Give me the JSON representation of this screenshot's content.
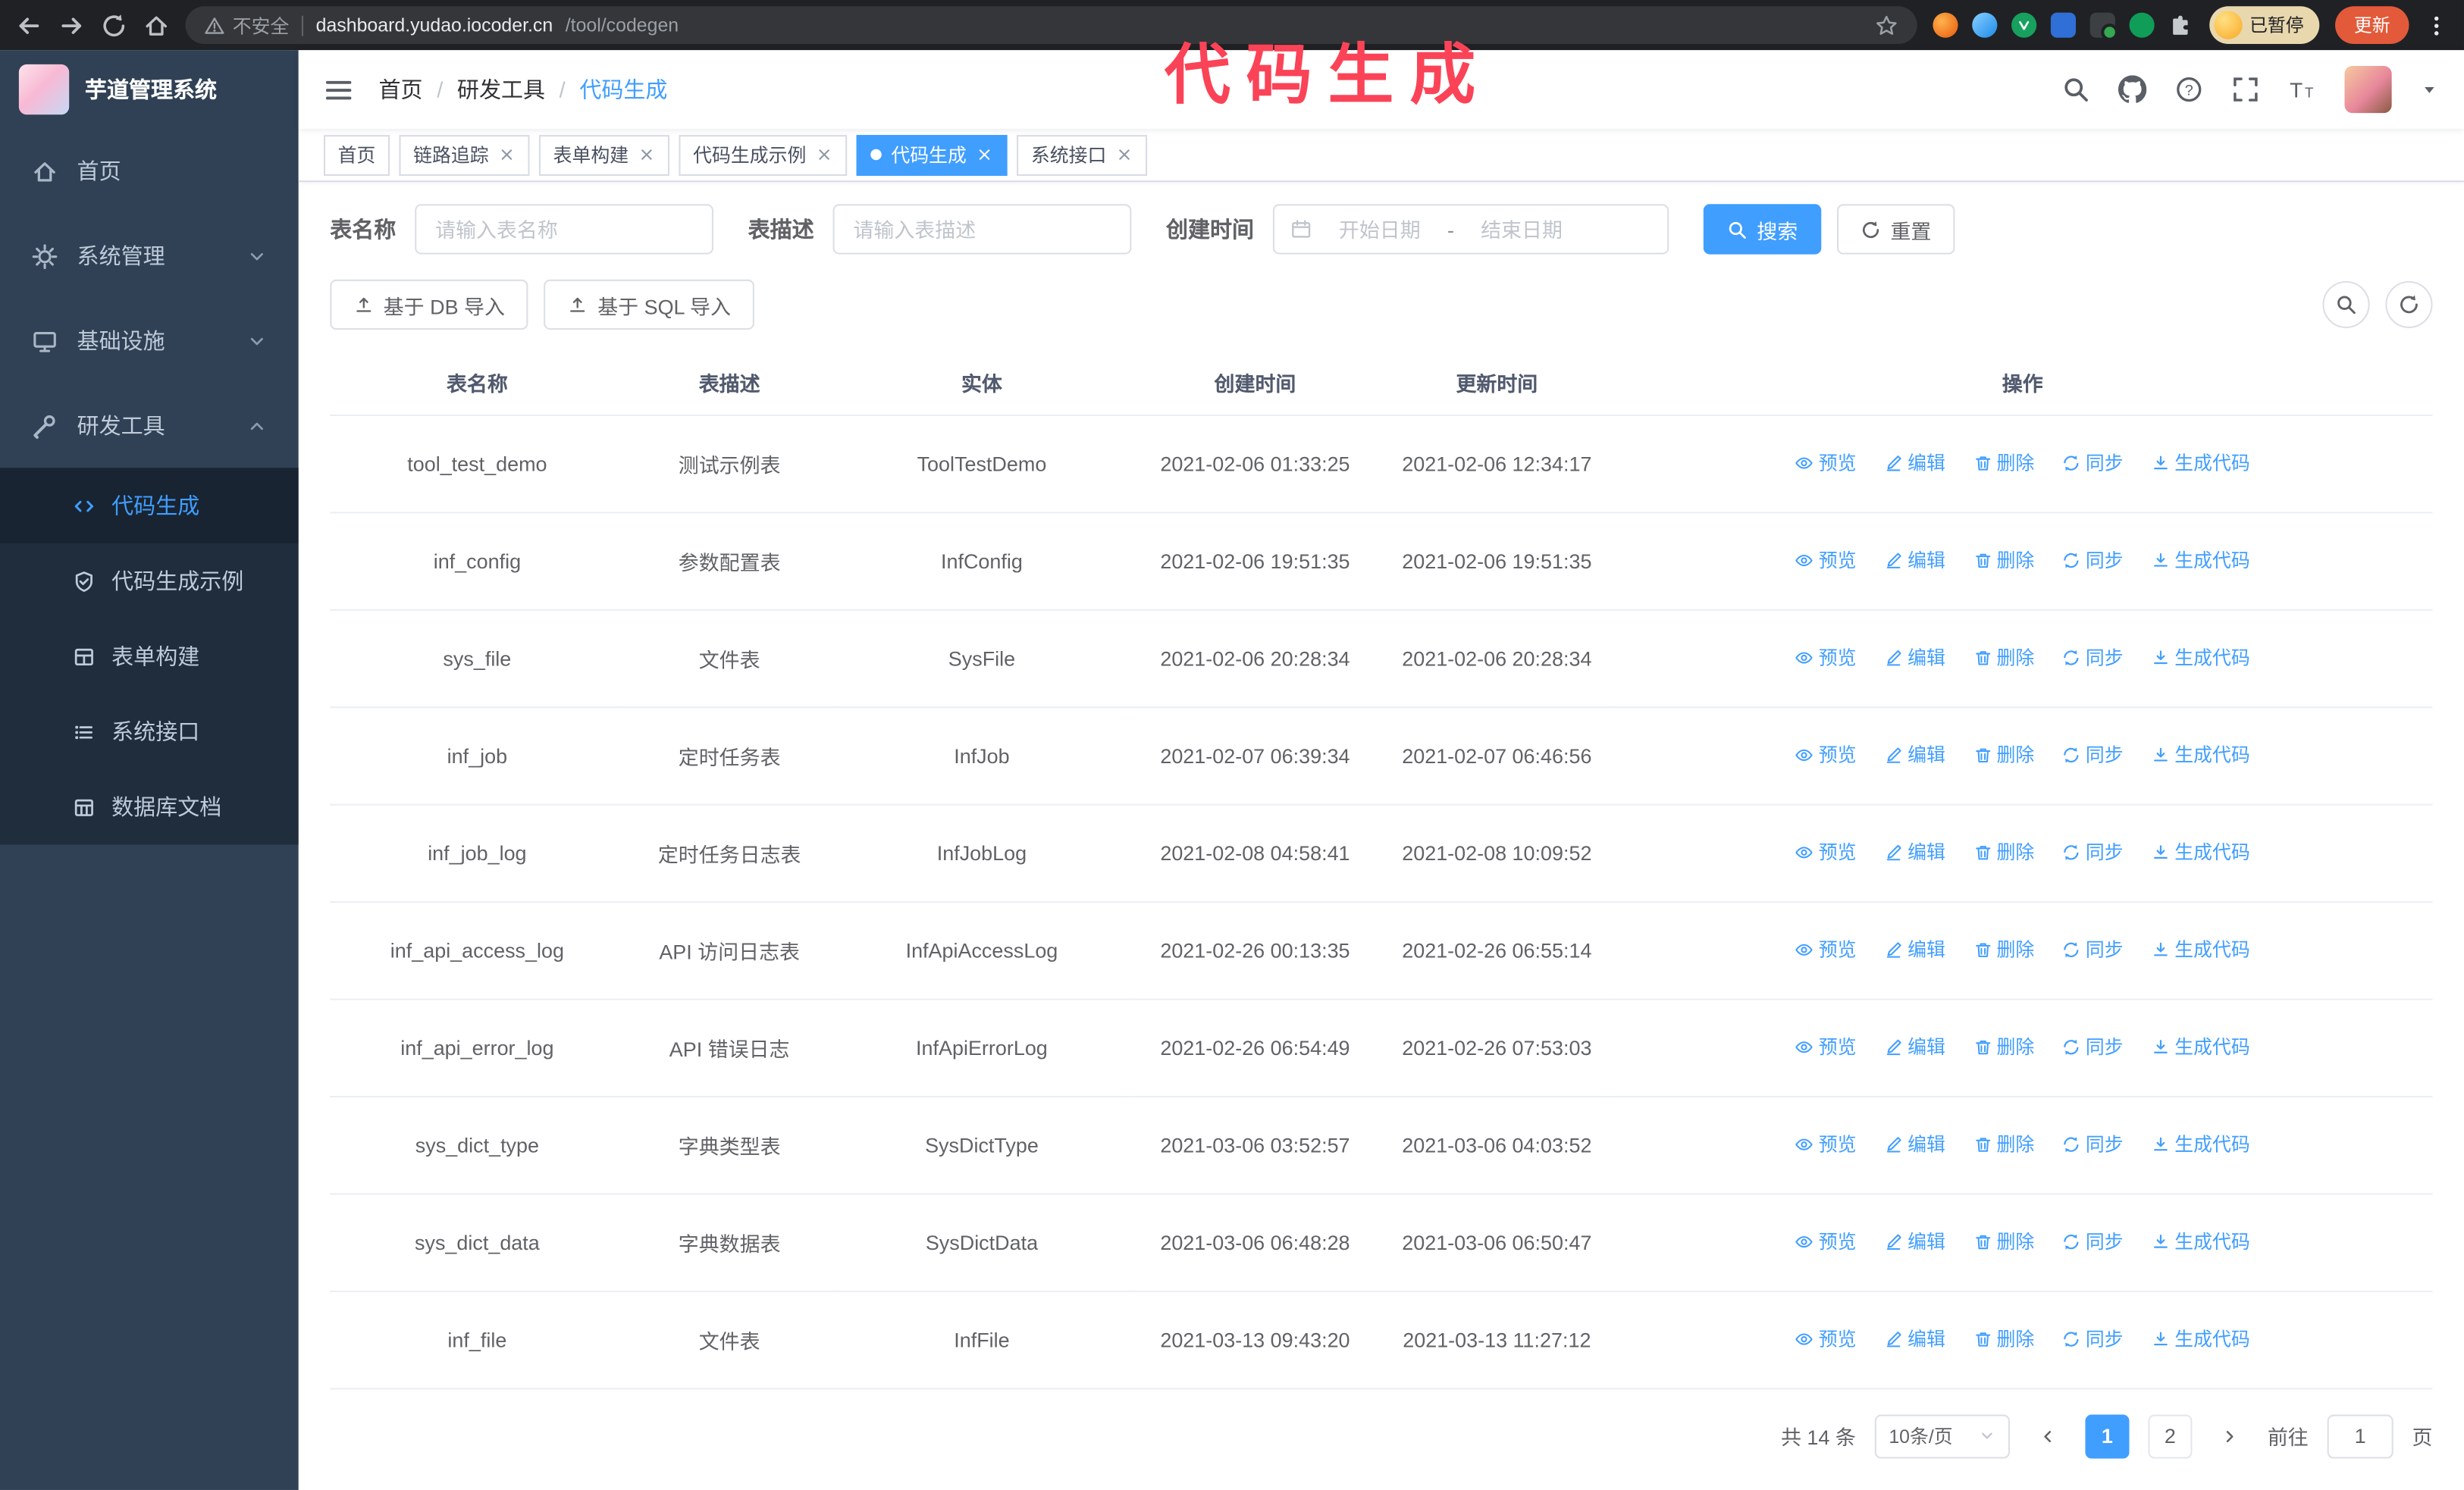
{
  "theme": {
    "accent": "#409eff",
    "sidebar_bg": "#304156",
    "submenu_bg": "#1f2d3d",
    "tab_active_bg": "#409eff",
    "annotation_color": "#fb4357",
    "update_button_bg": "#e25a3a"
  },
  "overlay": {
    "annotation": "代码生成"
  },
  "browser": {
    "security_warning": "不安全",
    "url_domain": "dashboard.yudao.iocoder.cn",
    "url_path": "/tool/codegen",
    "paused_badge": "已暂停",
    "update_button": "更新"
  },
  "sidebar": {
    "logo_title": "芋道管理系统",
    "items": [
      {
        "label": "首页"
      },
      {
        "label": "系统管理"
      },
      {
        "label": "基础设施"
      },
      {
        "label": "研发工具",
        "expanded": true
      }
    ],
    "subitems": [
      {
        "label": "代码生成",
        "active": true
      },
      {
        "label": "代码生成示例"
      },
      {
        "label": "表单构建"
      },
      {
        "label": "系统接口"
      },
      {
        "label": "数据库文档"
      }
    ]
  },
  "header": {
    "breadcrumb": [
      "首页",
      "研发工具",
      "代码生成"
    ],
    "breadcrumb_separator": "/"
  },
  "tabs": [
    {
      "label": "首页",
      "closable": false
    },
    {
      "label": "链路追踪",
      "closable": true
    },
    {
      "label": "表单构建",
      "closable": true
    },
    {
      "label": "代码生成示例",
      "closable": true
    },
    {
      "label": "代码生成",
      "closable": true,
      "active": true
    },
    {
      "label": "系统接口",
      "closable": true
    }
  ],
  "filters": {
    "table_name_label": "表名称",
    "table_name_placeholder": "请输入表名称",
    "table_desc_label": "表描述",
    "table_desc_placeholder": "请输入表描述",
    "create_time_label": "创建时间",
    "date_start_placeholder": "开始日期",
    "date_separator": "-",
    "date_end_placeholder": "结束日期",
    "search_button": "搜索",
    "reset_button": "重置"
  },
  "toolbar": {
    "import_db": "基于 DB 导入",
    "import_sql": "基于 SQL 导入"
  },
  "table": {
    "columns": [
      "表名称",
      "表描述",
      "实体",
      "创建时间",
      "更新时间",
      "操作"
    ],
    "actions": [
      "预览",
      "编辑",
      "删除",
      "同步",
      "生成代码"
    ],
    "rows": [
      {
        "name": "tool_test_demo",
        "desc": "测试示例表",
        "entity": "ToolTestDemo",
        "created": "2021-02-06 01:33:25",
        "updated": "2021-02-06 12:34:17"
      },
      {
        "name": "inf_config",
        "desc": "参数配置表",
        "entity": "InfConfig",
        "created": "2021-02-06 19:51:35",
        "updated": "2021-02-06 19:51:35"
      },
      {
        "name": "sys_file",
        "desc": "文件表",
        "entity": "SysFile",
        "created": "2021-02-06 20:28:34",
        "updated": "2021-02-06 20:28:34"
      },
      {
        "name": "inf_job",
        "desc": "定时任务表",
        "entity": "InfJob",
        "created": "2021-02-07 06:39:34",
        "updated": "2021-02-07 06:46:56"
      },
      {
        "name": "inf_job_log",
        "desc": "定时任务日志表",
        "entity": "InfJobLog",
        "created": "2021-02-08 04:58:41",
        "updated": "2021-02-08 10:09:52"
      },
      {
        "name": "inf_api_access_log",
        "desc": "API 访问日志表",
        "entity": "InfApiAccessLog",
        "created": "2021-02-26 00:13:35",
        "updated": "2021-02-26 06:55:14"
      },
      {
        "name": "inf_api_error_log",
        "desc": "API 错误日志",
        "entity": "InfApiErrorLog",
        "created": "2021-02-26 06:54:49",
        "updated": "2021-02-26 07:53:03"
      },
      {
        "name": "sys_dict_type",
        "desc": "字典类型表",
        "entity": "SysDictType",
        "created": "2021-03-06 03:52:57",
        "updated": "2021-03-06 04:03:52"
      },
      {
        "name": "sys_dict_data",
        "desc": "字典数据表",
        "entity": "SysDictData",
        "created": "2021-03-06 06:48:28",
        "updated": "2021-03-06 06:50:47"
      },
      {
        "name": "inf_file",
        "desc": "文件表",
        "entity": "InfFile",
        "created": "2021-03-13 09:43:20",
        "updated": "2021-03-13 11:27:12"
      }
    ]
  },
  "pagination": {
    "total": "共 14 条",
    "page_size": "10条/页",
    "pages": [
      "1",
      "2"
    ],
    "active_page": "1",
    "goto_label": "前往",
    "goto_value": "1",
    "page_suffix": "页"
  }
}
